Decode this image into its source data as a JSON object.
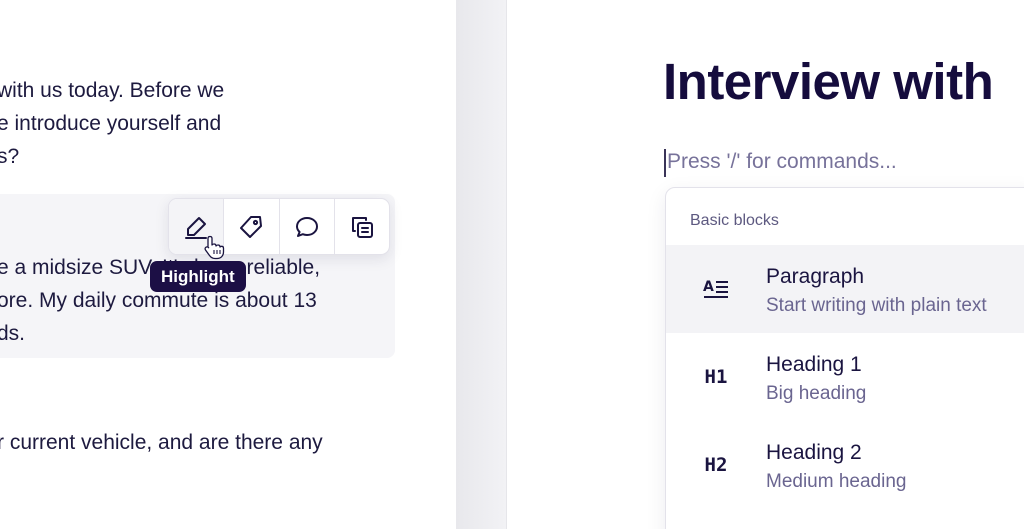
{
  "left_document": {
    "question_lines": [
      "with us today. Before we",
      "e introduce yourself and",
      "s?"
    ],
    "answer_lines": [
      "e a midsize SUV. It's been reliable,",
      "ore. My daily commute is about 13",
      "ds."
    ],
    "next_question_line": "r current vehicle, and are there any"
  },
  "selection_toolbar": {
    "buttons": [
      {
        "icon": "highlight-pen-icon",
        "active": true
      },
      {
        "icon": "tag-icon",
        "active": false
      },
      {
        "icon": "comment-bubble-icon",
        "active": false
      },
      {
        "icon": "copy-to-note-icon",
        "active": false
      }
    ],
    "tooltip": "Highlight"
  },
  "editor": {
    "title": "Interview with",
    "placeholder": "Press '/' for commands...",
    "block_menu": {
      "section_label": "Basic blocks",
      "items": [
        {
          "icon": "paragraph-icon",
          "icon_text": "",
          "title": "Paragraph",
          "description": "Start writing with plain text",
          "selected": true
        },
        {
          "icon": "heading-1-icon",
          "icon_text": "H1",
          "title": "Heading 1",
          "description": "Big heading",
          "selected": false
        },
        {
          "icon": "heading-2-icon",
          "icon_text": "H2",
          "title": "Heading 2",
          "description": "Medium heading",
          "selected": false
        }
      ]
    }
  },
  "colors": {
    "tooltip_bg": "#1c0f45",
    "title_text": "#150c3d",
    "muted_text": "#6a6590",
    "selected_row_bg": "#f3f3f6"
  }
}
